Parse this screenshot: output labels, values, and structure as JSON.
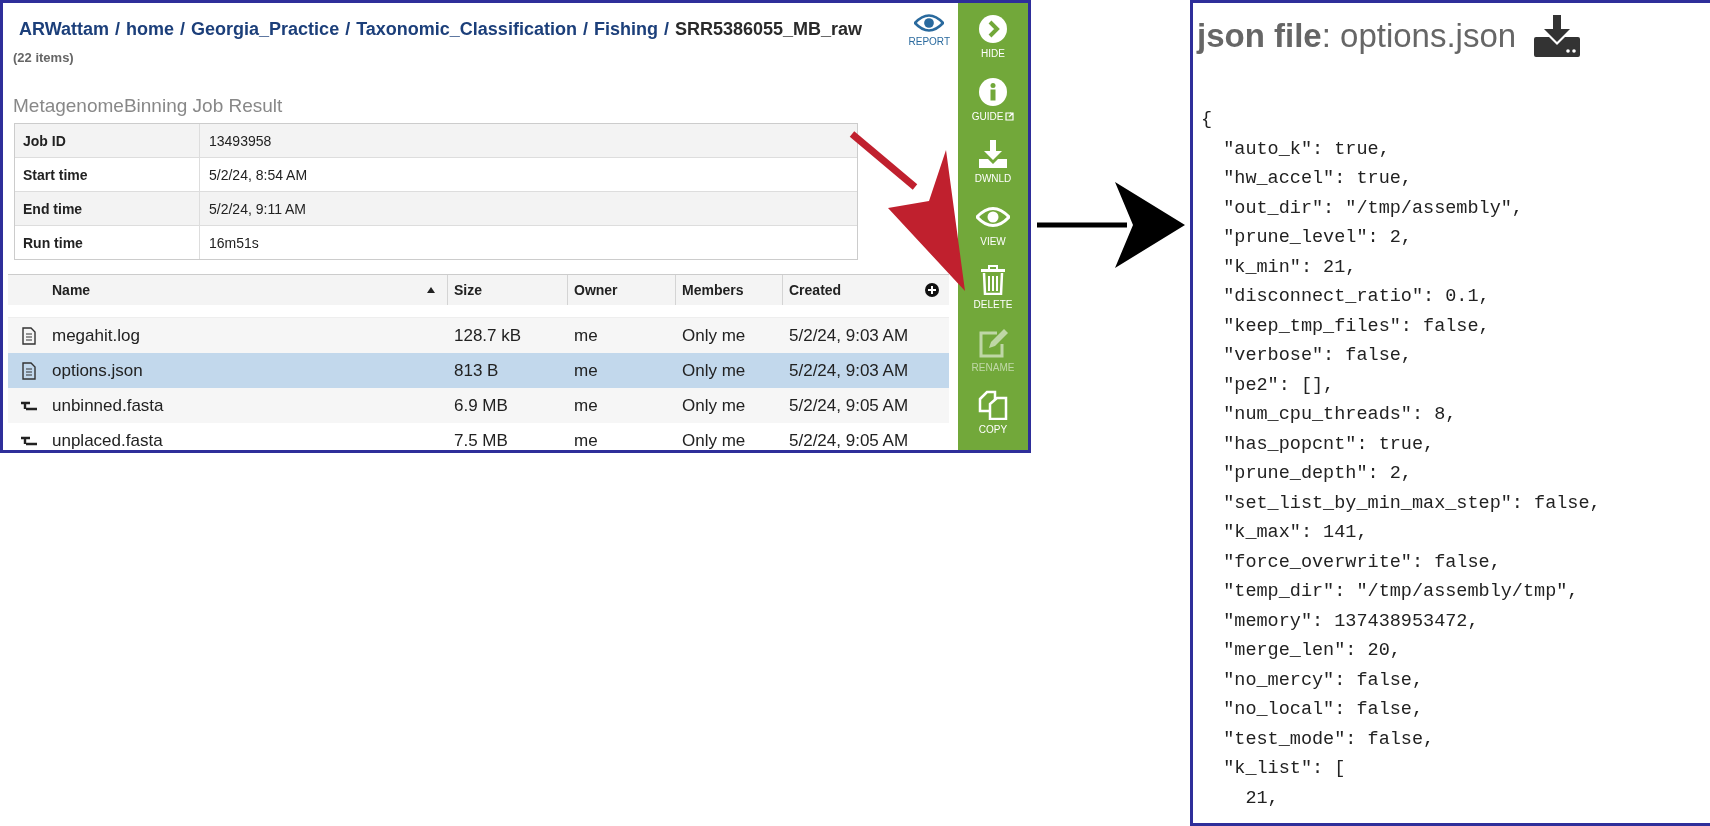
{
  "breadcrumb_separator": "/",
  "breadcrumb": [
    {
      "label": "ARWattam",
      "current": false
    },
    {
      "label": "home",
      "current": false
    },
    {
      "label": "Georgia_Practice",
      "current": false
    },
    {
      "label": "Taxonomic_Classification",
      "current": false
    },
    {
      "label": "Fishing",
      "current": false
    },
    {
      "label": "SRR5386055_MB_raw",
      "current": true
    }
  ],
  "item_count": "(22 items)",
  "report_button": {
    "label": "REPORT"
  },
  "job_result": {
    "title": "MetagenomeBinning Job Result",
    "rows": [
      {
        "label": "Job ID",
        "value": "13493958"
      },
      {
        "label": "Start time",
        "value": "5/2/24, 8:54 AM"
      },
      {
        "label": "End time",
        "value": "5/2/24, 9:11 AM"
      },
      {
        "label": "Run time",
        "value": "16m51s"
      }
    ]
  },
  "file_table": {
    "columns": [
      {
        "label": "Name",
        "sorted": true
      },
      {
        "label": "Size",
        "sorted": false
      },
      {
        "label": "Owner",
        "sorted": false
      },
      {
        "label": "Members",
        "sorted": false
      },
      {
        "label": "Created",
        "sorted": false
      }
    ],
    "rows": [
      {
        "kind": "text",
        "name": "megahit.log",
        "size": "128.7 kB",
        "owner": "me",
        "members": "Only me",
        "created": "5/2/24, 9:03 AM",
        "selected": false
      },
      {
        "kind": "text",
        "name": "options.json",
        "size": "813 B",
        "owner": "me",
        "members": "Only me",
        "created": "5/2/24, 9:03 AM",
        "selected": true
      },
      {
        "kind": "sequence",
        "name": "unbinned.fasta",
        "size": "6.9 MB",
        "owner": "me",
        "members": "Only me",
        "created": "5/2/24, 9:05 AM",
        "selected": false
      },
      {
        "kind": "sequence",
        "name": "unplaced.fasta",
        "size": "7.5 MB",
        "owner": "me",
        "members": "Only me",
        "created": "5/2/24, 9:05 AM",
        "selected": false
      }
    ]
  },
  "action_bar": {
    "buttons": [
      {
        "kind": "hide",
        "label": "HIDE",
        "disabled": false
      },
      {
        "kind": "guide",
        "label": "GUIDE",
        "disabled": false
      },
      {
        "kind": "download",
        "label": "DWNLD",
        "disabled": false
      },
      {
        "kind": "view",
        "label": "VIEW",
        "disabled": false
      },
      {
        "kind": "delete",
        "label": "DELETE",
        "disabled": false
      },
      {
        "kind": "rename",
        "label": "RENAME",
        "disabled": true
      },
      {
        "kind": "copy",
        "label": "COPY",
        "disabled": false
      }
    ]
  },
  "viewer": {
    "title": "**json file**: options.json",
    "lines": [
      "{",
      "  \"auto_k\": true,",
      "  \"hw_accel\": true,",
      "  \"out_dir\": \"/tmp/assembly\",",
      "  \"prune_level\": 2,",
      "  \"k_min\": 21,",
      "  \"disconnect_ratio\": 0.1,",
      "  \"keep_tmp_files\": false,",
      "  \"verbose\": false,",
      "  \"pe2\": [],",
      "  \"num_cpu_threads\": 8,",
      "  \"has_popcnt\": true,",
      "  \"prune_depth\": 2,",
      "  \"set_list_by_min_max_step\": false,",
      "  \"k_max\": 141,",
      "  \"force_overwrite\": false,",
      "  \"temp_dir\": \"/tmp/assembly/tmp\",",
      "  \"memory\": 137438953472,",
      "  \"merge_len\": 20,",
      "  \"no_mercy\": false,",
      "  \"no_local\": false,",
      "  \"test_mode\": false,",
      "  \"k_list\": [",
      "    21,"
    ]
  }
}
